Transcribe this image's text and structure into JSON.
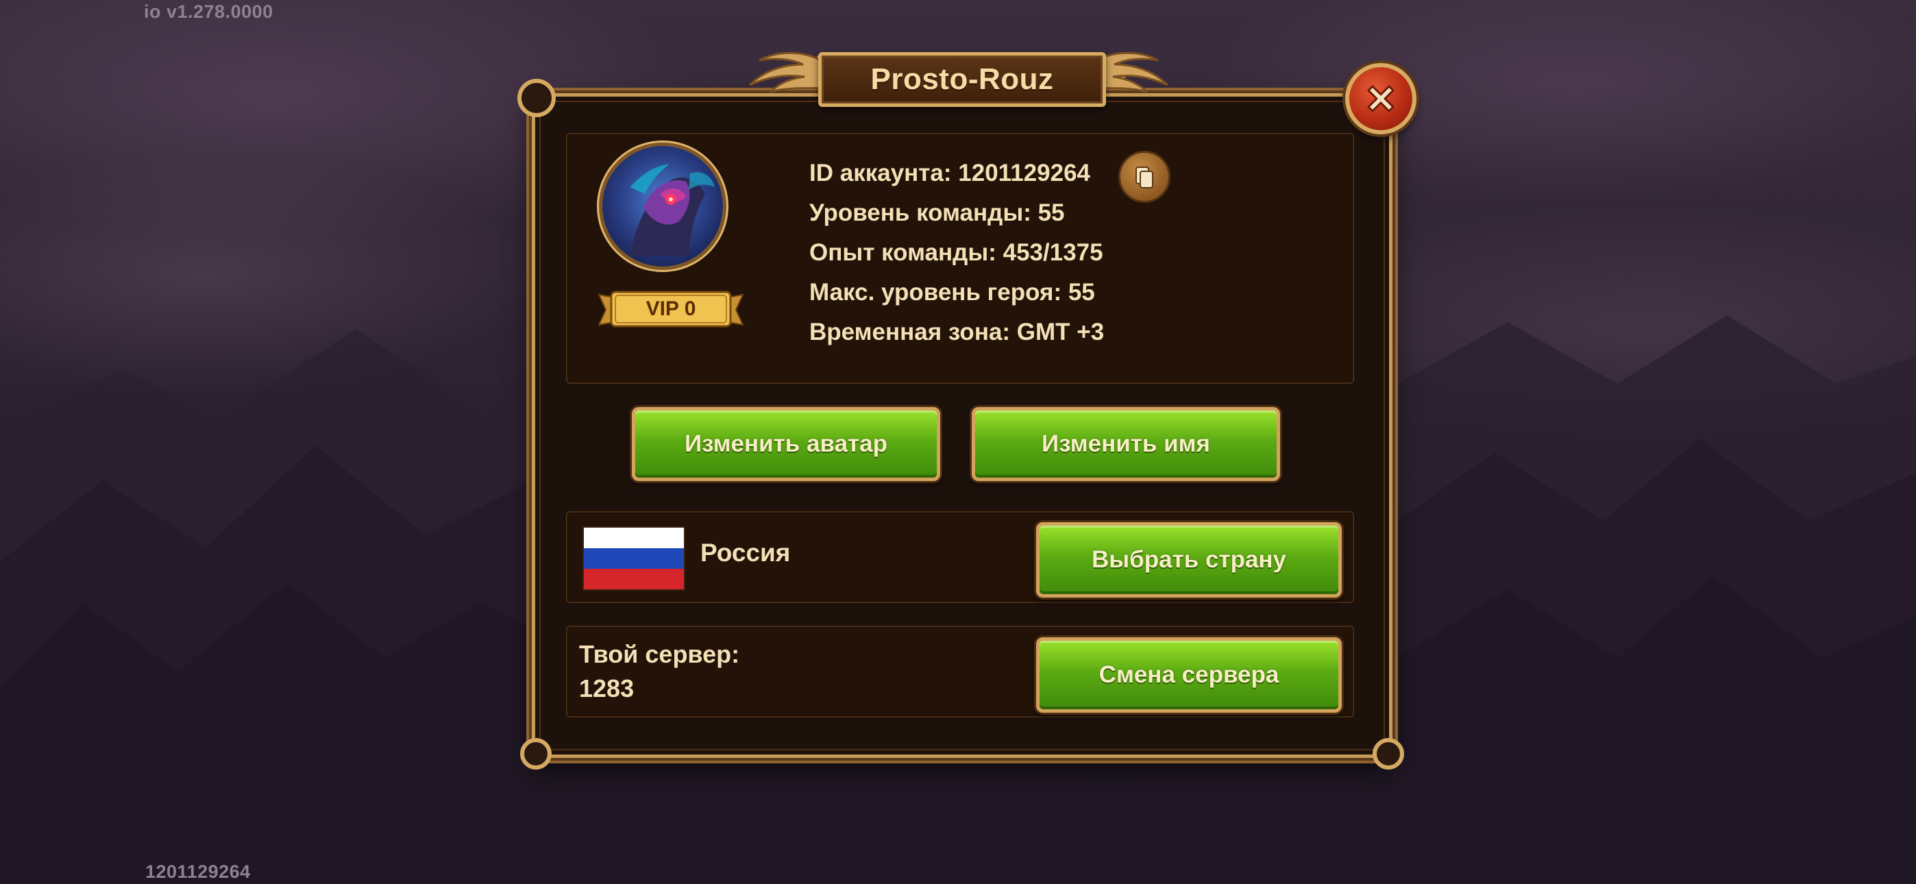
{
  "app": {
    "version": "io v1.278.0000",
    "footer_id": "1201129264"
  },
  "dialog": {
    "title": "Prosto-Rouz",
    "close_icon": "close-icon"
  },
  "profile": {
    "vip_label": "VIP 0",
    "avatar_icon": "hero-avatar",
    "copy_icon": "copy-icon",
    "info": {
      "account_id": "ID аккаунта: 1201129264",
      "team_level": "Уровень команды: 55",
      "team_exp": "Опыт команды: 453/1375",
      "max_hero_level": "Макс. уровень героя: 55",
      "timezone": "Временная зона: GMT +3"
    },
    "buttons": {
      "change_avatar": "Изменить аватар",
      "change_name": "Изменить имя"
    }
  },
  "country": {
    "name": "Россия",
    "flag_icon": "russia-flag-icon",
    "button": "Выбрать страну"
  },
  "server": {
    "label": "Твой сервер:",
    "number": "1283",
    "button": "Смена сервера"
  },
  "colors": {
    "panel_bg": "#1d110b",
    "gold_border": "#c89a57",
    "button_green": "#5cab12",
    "text_cream": "#f3e0b6"
  }
}
